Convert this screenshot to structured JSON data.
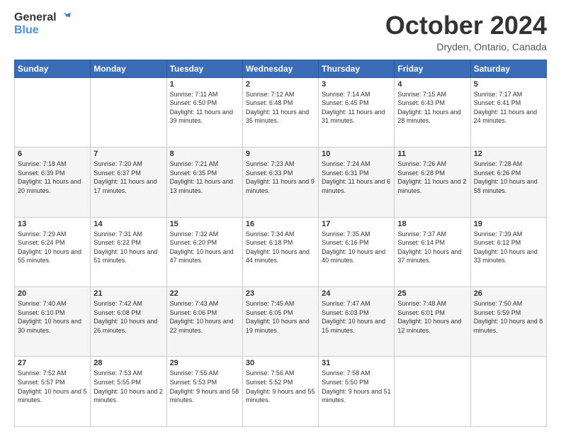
{
  "header": {
    "logo_line1": "General",
    "logo_line2": "Blue",
    "month": "October 2024",
    "location": "Dryden, Ontario, Canada"
  },
  "weekdays": [
    "Sunday",
    "Monday",
    "Tuesday",
    "Wednesday",
    "Thursday",
    "Friday",
    "Saturday"
  ],
  "weeks": [
    [
      {
        "day": "",
        "info": ""
      },
      {
        "day": "",
        "info": ""
      },
      {
        "day": "1",
        "info": "Sunrise: 7:11 AM\nSunset: 6:50 PM\nDaylight: 11 hours and 39 minutes."
      },
      {
        "day": "2",
        "info": "Sunrise: 7:12 AM\nSunset: 6:48 PM\nDaylight: 11 hours and 35 minutes."
      },
      {
        "day": "3",
        "info": "Sunrise: 7:14 AM\nSunset: 6:45 PM\nDaylight: 11 hours and 31 minutes."
      },
      {
        "day": "4",
        "info": "Sunrise: 7:15 AM\nSunset: 6:43 PM\nDaylight: 11 hours and 28 minutes."
      },
      {
        "day": "5",
        "info": "Sunrise: 7:17 AM\nSunset: 6:41 PM\nDaylight: 11 hours and 24 minutes."
      }
    ],
    [
      {
        "day": "6",
        "info": "Sunrise: 7:18 AM\nSunset: 6:39 PM\nDaylight: 11 hours and 20 minutes."
      },
      {
        "day": "7",
        "info": "Sunrise: 7:20 AM\nSunset: 6:37 PM\nDaylight: 11 hours and 17 minutes."
      },
      {
        "day": "8",
        "info": "Sunrise: 7:21 AM\nSunset: 6:35 PM\nDaylight: 11 hours and 13 minutes."
      },
      {
        "day": "9",
        "info": "Sunrise: 7:23 AM\nSunset: 6:33 PM\nDaylight: 11 hours and 9 minutes."
      },
      {
        "day": "10",
        "info": "Sunrise: 7:24 AM\nSunset: 6:31 PM\nDaylight: 11 hours and 6 minutes."
      },
      {
        "day": "11",
        "info": "Sunrise: 7:26 AM\nSunset: 6:28 PM\nDaylight: 11 hours and 2 minutes."
      },
      {
        "day": "12",
        "info": "Sunrise: 7:28 AM\nSunset: 6:26 PM\nDaylight: 10 hours and 58 minutes."
      }
    ],
    [
      {
        "day": "13",
        "info": "Sunrise: 7:29 AM\nSunset: 6:24 PM\nDaylight: 10 hours and 55 minutes."
      },
      {
        "day": "14",
        "info": "Sunrise: 7:31 AM\nSunset: 6:22 PM\nDaylight: 10 hours and 51 minutes."
      },
      {
        "day": "15",
        "info": "Sunrise: 7:32 AM\nSunset: 6:20 PM\nDaylight: 10 hours and 47 minutes."
      },
      {
        "day": "16",
        "info": "Sunrise: 7:34 AM\nSunset: 6:18 PM\nDaylight: 10 hours and 44 minutes."
      },
      {
        "day": "17",
        "info": "Sunrise: 7:35 AM\nSunset: 6:16 PM\nDaylight: 10 hours and 40 minutes."
      },
      {
        "day": "18",
        "info": "Sunrise: 7:37 AM\nSunset: 6:14 PM\nDaylight: 10 hours and 37 minutes."
      },
      {
        "day": "19",
        "info": "Sunrise: 7:39 AM\nSunset: 6:12 PM\nDaylight: 10 hours and 33 minutes."
      }
    ],
    [
      {
        "day": "20",
        "info": "Sunrise: 7:40 AM\nSunset: 6:10 PM\nDaylight: 10 hours and 30 minutes."
      },
      {
        "day": "21",
        "info": "Sunrise: 7:42 AM\nSunset: 6:08 PM\nDaylight: 10 hours and 26 minutes."
      },
      {
        "day": "22",
        "info": "Sunrise: 7:43 AM\nSunset: 6:06 PM\nDaylight: 10 hours and 22 minutes."
      },
      {
        "day": "23",
        "info": "Sunrise: 7:45 AM\nSunset: 6:05 PM\nDaylight: 10 hours and 19 minutes."
      },
      {
        "day": "24",
        "info": "Sunrise: 7:47 AM\nSunset: 6:03 PM\nDaylight: 10 hours and 15 minutes."
      },
      {
        "day": "25",
        "info": "Sunrise: 7:48 AM\nSunset: 6:01 PM\nDaylight: 10 hours and 12 minutes."
      },
      {
        "day": "26",
        "info": "Sunrise: 7:50 AM\nSunset: 5:59 PM\nDaylight: 10 hours and 8 minutes."
      }
    ],
    [
      {
        "day": "27",
        "info": "Sunrise: 7:52 AM\nSunset: 5:57 PM\nDaylight: 10 hours and 5 minutes."
      },
      {
        "day": "28",
        "info": "Sunrise: 7:53 AM\nSunset: 5:55 PM\nDaylight: 10 hours and 2 minutes."
      },
      {
        "day": "29",
        "info": "Sunrise: 7:55 AM\nSunset: 5:53 PM\nDaylight: 9 hours and 58 minutes."
      },
      {
        "day": "30",
        "info": "Sunrise: 7:56 AM\nSunset: 5:52 PM\nDaylight: 9 hours and 55 minutes."
      },
      {
        "day": "31",
        "info": "Sunrise: 7:58 AM\nSunset: 5:50 PM\nDaylight: 9 hours and 51 minutes."
      },
      {
        "day": "",
        "info": ""
      },
      {
        "day": "",
        "info": ""
      }
    ]
  ]
}
